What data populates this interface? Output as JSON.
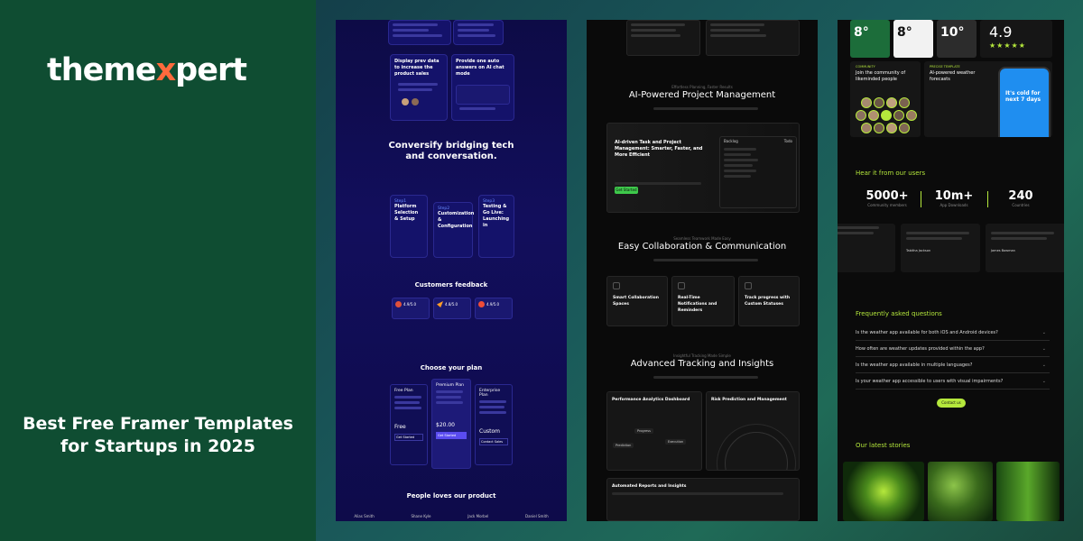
{
  "brand": {
    "logo_pre": "theme",
    "logo_x": "x",
    "logo_post": "pert",
    "headline_line1": "Best Free Framer Templates",
    "headline_line2": "for Startups in 2025"
  },
  "mock1": {
    "card1_title": "Display prev data to increase the product sales",
    "card2_title": "Provide one auto answers on AI chat mode",
    "section_title1": "Conversify bridging tech",
    "section_title2": "and conversation.",
    "steps": [
      {
        "num": "Step1",
        "title": "Platform Selection & Setup"
      },
      {
        "num": "Step2",
        "title": "Customization & Configuration"
      },
      {
        "num": "Step3",
        "title": "Testing & Go Live: Launching in"
      }
    ],
    "feedback_title": "Customers feedback",
    "reviews": [
      "4.9/5.0",
      "4.8/5.0",
      "4.9/5.0"
    ],
    "plan_title": "Choose your plan",
    "plans": [
      {
        "name": "Free Plan",
        "price": "Free",
        "btn": "Get Started"
      },
      {
        "name": "Premium Plan",
        "price": "$20.00",
        "btn": "Get Started"
      },
      {
        "name": "Enterprise Plan",
        "price": "Custom",
        "btn": "Contact Sales"
      }
    ],
    "people_title": "People loves our product",
    "people": [
      "Alias Smith",
      "Shane Kyle",
      "Jack Morbel",
      "Daniel Smith"
    ]
  },
  "mock2": {
    "pm_eyebrow": "Effortless Planning, Faster Results",
    "pm_title": "AI-Powered Project Management",
    "task_title": "AI-driven Task and Project Management: Smarter, Faster, and More Efficient",
    "task_btn": "Get Started",
    "backlog_label": "Backlog",
    "todo_label": "Todo",
    "collab_eyebrow": "Seamless Teamwork Made Easy",
    "collab_title": "Easy Collaboration & Communication",
    "features": [
      "Smart Collaboration Spaces",
      "Real-Time Notifications and Reminders",
      "Track progress with Custom Statuses"
    ],
    "tracking_eyebrow": "Insightful Tracking Made Simple",
    "tracking_title": "Advanced Tracking and Insights",
    "analytics_title": "Performance Analytics Dashboard",
    "risk_title": "Risk Prediction and Management",
    "reports_title": "Automated Reports and Insights",
    "tag_progress": "Progress",
    "tag_prediction": "Prediction",
    "tag_execution": "Execution"
  },
  "mock3": {
    "temps": [
      "8°",
      "8°",
      "10°"
    ],
    "rating": "4.9",
    "stars": "★★★★★",
    "community_label": "COMMUNITY",
    "community_text": "Join the community of likeminded people",
    "template_label": "PRECISE TEMPLATE",
    "template_text": "AI-powered weather forecasts",
    "phone_text": "It's cold for next 7 days",
    "hear_title": "Hear it from our users",
    "stats": [
      {
        "value": "5000+",
        "label": "Community members"
      },
      {
        "value": "10m+",
        "label": "App Downloads"
      },
      {
        "value": "240",
        "label": "Countries"
      }
    ],
    "reviewers": [
      "Tabitha Jackson",
      "James Bowman"
    ],
    "faq_title": "Frequently asked questions",
    "faqs": [
      "Is the weather app available for both iOS and Android devices?",
      "How often are weather updates provided within the app?",
      "Is the weather app available in multiple languages?",
      "Is your weather app accessible to users with visual impairments?"
    ],
    "contact_btn": "Contact us",
    "stories_title": "Our latest stories"
  },
  "colors": {
    "brand_bg": "#0f4d32",
    "logo_accent": "#ff6a3d",
    "mock1_bg": "#0d0b46",
    "mock3_accent": "#b5e83c",
    "mock2_btn": "#3ec94b"
  }
}
